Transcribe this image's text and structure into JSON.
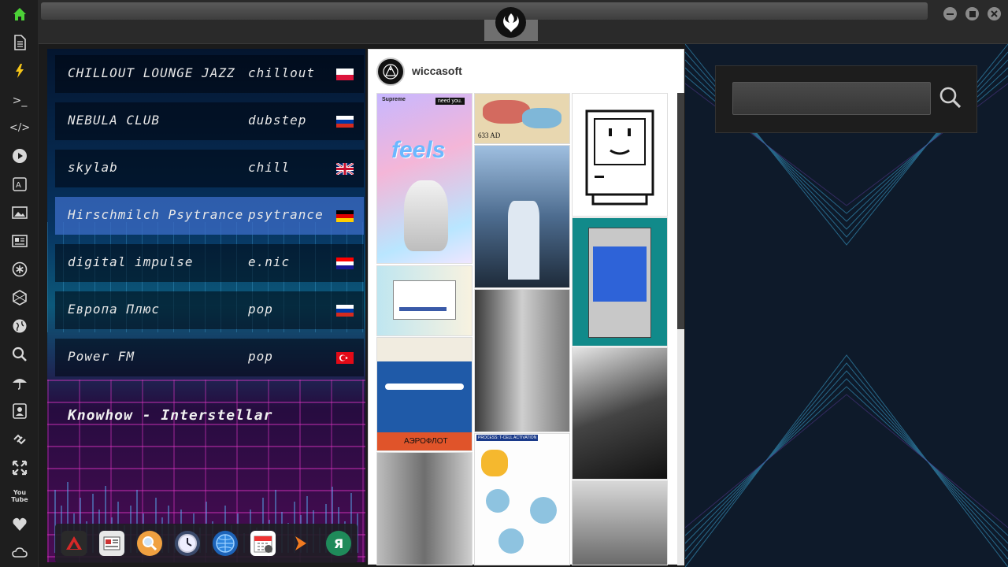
{
  "sidebar": {
    "icons": [
      "home-icon",
      "document-icon",
      "lightning-icon",
      "terminal-icon",
      "code-icon",
      "play-icon",
      "translate-icon",
      "image-icon",
      "news-icon",
      "asterisk-icon",
      "hexagon-icon",
      "globe-icon",
      "search-icon",
      "umbrella-icon",
      "contacts-icon",
      "link-icon",
      "expand-icon",
      "youtube-icon",
      "heart-icon",
      "cloud-icon"
    ],
    "terminal_glyph": ">_",
    "code_glyph": "</>",
    "youtube_label": "You Tube"
  },
  "radio": {
    "stations": [
      {
        "name": "CHILLOUT LOUNGE JAZZ",
        "genre": "chillout",
        "flag": "PL"
      },
      {
        "name": "NEBULA CLUB",
        "genre": "dubstep",
        "flag": "RU"
      },
      {
        "name": "skylab",
        "genre": "chill",
        "flag": "GB"
      },
      {
        "name": "Hirschmilch Psytrance",
        "genre": "psytrance",
        "flag": "DE"
      },
      {
        "name": "digital impulse",
        "genre": "e.nic",
        "flag": "HR"
      },
      {
        "name": "Европа Плюс",
        "genre": "pop",
        "flag": "RU"
      },
      {
        "name": "Power FM",
        "genre": "pop",
        "flag": "TR"
      }
    ],
    "active_index": 3,
    "now_playing": "Knowhow - Interstellar"
  },
  "dock": {
    "items": [
      "altium-icon",
      "news-reader-icon",
      "magnifier-icon",
      "clock-icon",
      "globe-browser-icon",
      "calendar-icon",
      "arrow-launcher-icon",
      "yandex-icon"
    ],
    "yandex_glyph": "Я"
  },
  "insta": {
    "username": "wiccasoft",
    "tiles": {
      "feels": "feels",
      "supreme": "Supreme",
      "need_you": "need you.",
      "map_caption": "633 AD",
      "aeroflot": "АЭРОФЛОТ",
      "tcell_title": "PROCESS: T-CELL ACTIVATION"
    }
  },
  "search": {
    "placeholder": ""
  },
  "colors": {
    "active_station": "#3c6ec8",
    "sidebar_green": "#4cd137",
    "lightning_yellow": "#f5c518"
  }
}
